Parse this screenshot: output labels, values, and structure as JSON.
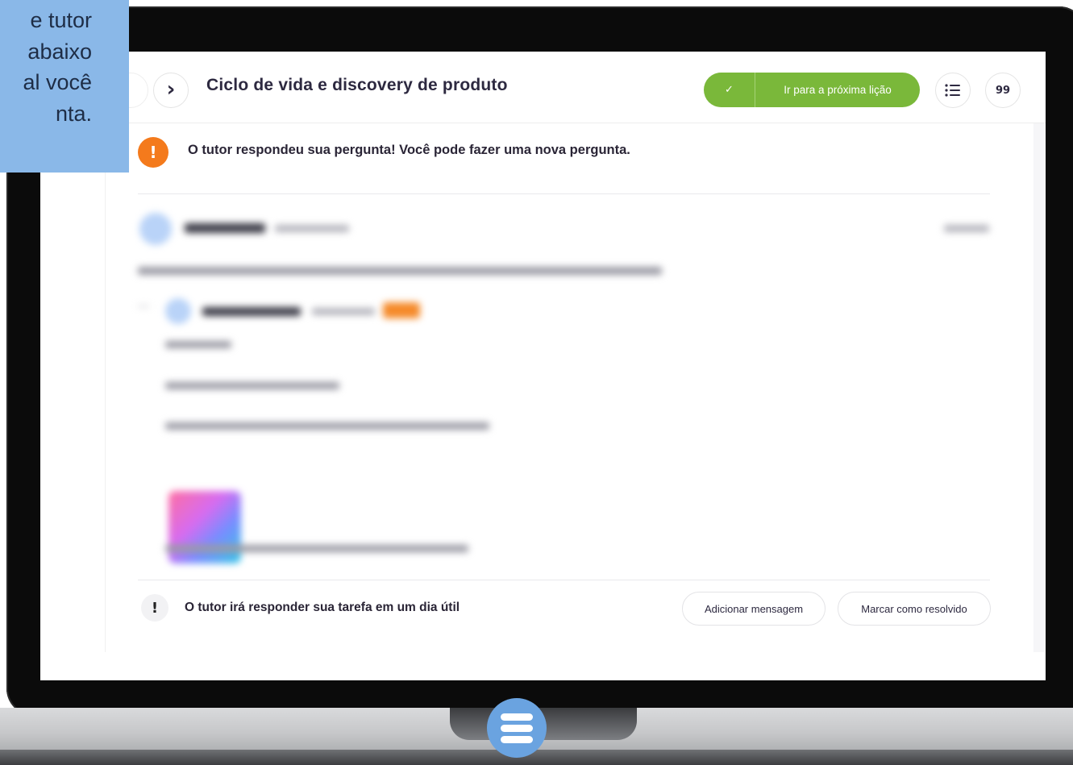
{
  "tooltip": {
    "text": "e tutor\n abaixo\nal você\nnta."
  },
  "header": {
    "title": "Ciclo de vida e discovery de produto",
    "next_label": "›",
    "next_lesson_check": "✓",
    "next_lesson_label": "Ir para a próxima lição",
    "list_icon": "≡",
    "quote_label": "99"
  },
  "alert": {
    "icon": "!",
    "text": "O tutor respondeu sua pergunta! Você pode fazer uma nova pergunta."
  },
  "footer_bar": {
    "icon": "!",
    "text": "O tutor irá responder sua tarefa em um dia útil",
    "add_message_label": "Adicionar mensagem",
    "resolve_label": "Marcar como resolvido"
  },
  "colors": {
    "accent_green": "#7ab83a",
    "alert_orange": "#f47a1c",
    "tooltip_blue": "#8ab8e8",
    "fab_blue": "#6aa3e0"
  }
}
